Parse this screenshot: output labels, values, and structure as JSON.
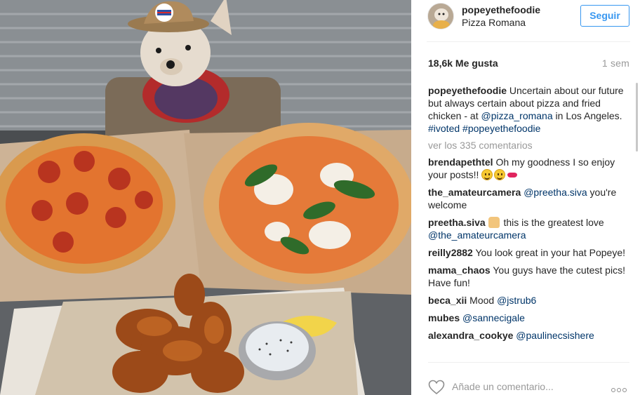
{
  "post": {
    "username": "popeyethefoodie",
    "location": "Pizza Romana",
    "follow_label": "Seguir",
    "likes": "18,6k Me gusta",
    "age": "1 sem"
  },
  "caption": {
    "user": "popeyethefoodie",
    "text_1": "Uncertain about our future but always certain about pizza and fried chicken - at ",
    "mention": "@pizza_romana",
    "text_2": " in Los Angeles. ",
    "tag_1": "#ivoted",
    "tag_2": "#popeyethefoodie"
  },
  "view_all": "ver los 335 comentarios",
  "comments": [
    {
      "user": "brendapethtel",
      "text": "Oh my goodness I so enjoy your posts!! "
    },
    {
      "user": "the_amateurcamera",
      "mention": "@preetha.siva",
      "text": " you're welcome"
    },
    {
      "user": "preetha.siva",
      "text": " this is the greatest love ",
      "mention": "@the_amateurcamera"
    },
    {
      "user": "reilly2882",
      "text": "You look great in your hat Popeye!"
    },
    {
      "user": "mama_chaos",
      "text": "You guys have the cutest pics! Have fun!"
    },
    {
      "user": "beca_xii",
      "text": "Mood ",
      "mention": "@jstrub6"
    },
    {
      "user": "mubes",
      "mention": "@sannecigale"
    },
    {
      "user": "alexandra_cookye",
      "mention": "@paulinecsishere"
    }
  ],
  "add_comment": {
    "placeholder": "Añade un comentario..."
  },
  "icons": {
    "like": "heart-icon",
    "more": "more-options-icon",
    "emoji_smile": "smiley-emoji",
    "emoji_kiss": "kiss-lips-emoji",
    "emoji_hands": "raised-hands-emoji"
  },
  "colors": {
    "follow_blue": "#3897f0",
    "link_navy": "#003569",
    "muted_gray": "#999999"
  }
}
